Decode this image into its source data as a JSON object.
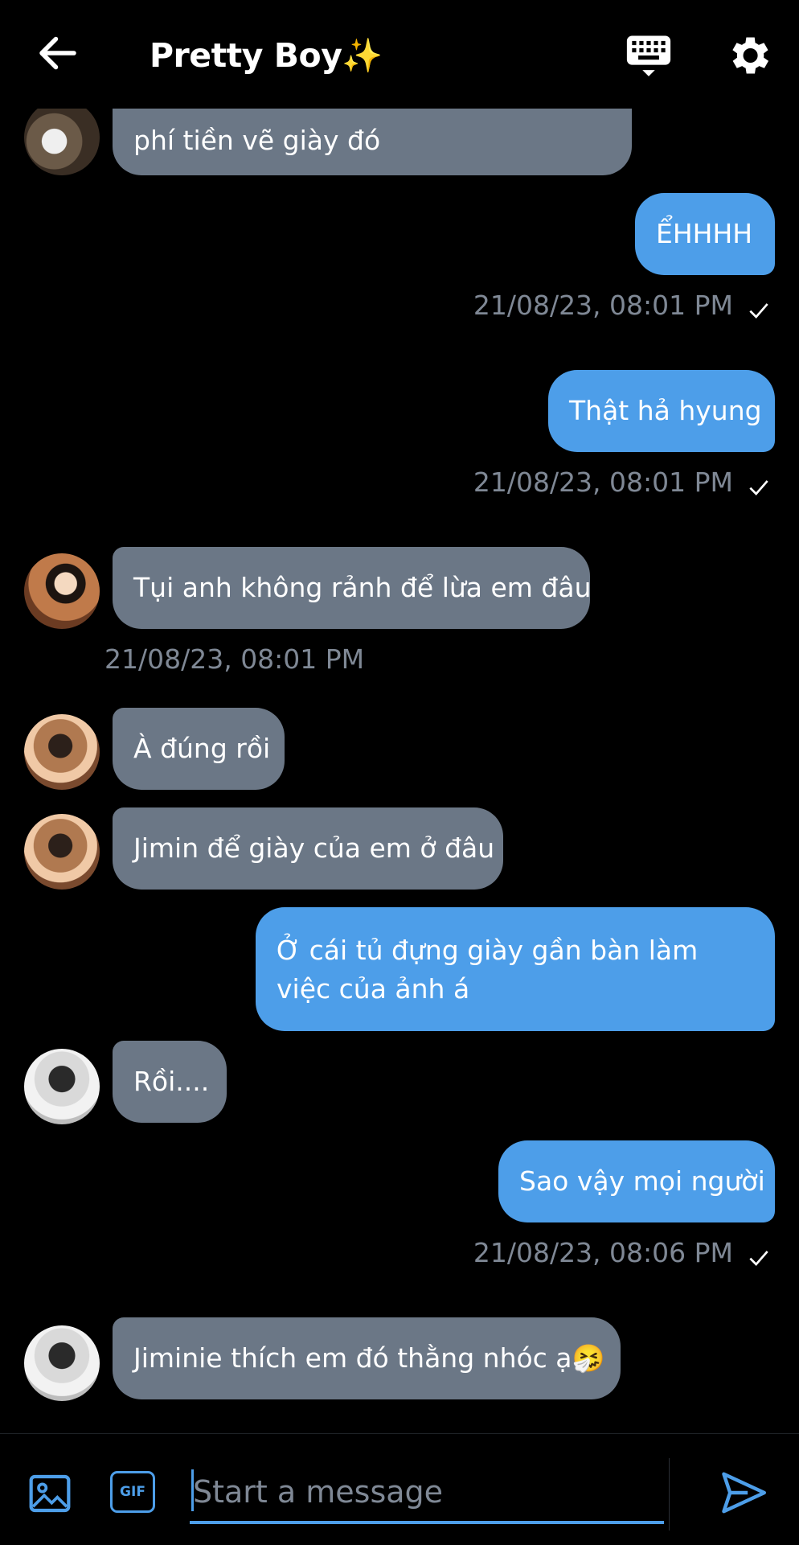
{
  "header": {
    "title": "Pretty Boy✨",
    "back_icon": "arrow-left-icon",
    "keyboard_icon": "keyboard-icon",
    "settings_icon": "gear-icon"
  },
  "messages": [
    {
      "dir": "in",
      "text": "phí tiền vẽ giày đó"
    },
    {
      "dir": "out",
      "text": "ỂHHHH"
    },
    {
      "dir": "meta",
      "text": "21/08/23, 08:01 PM"
    },
    {
      "dir": "out",
      "text": "Thật hả hyung"
    },
    {
      "dir": "meta",
      "text": "21/08/23, 08:01 PM"
    },
    {
      "dir": "in",
      "text": "Tụi anh không rảnh để lừa em đâu"
    },
    {
      "dir": "meta",
      "text": "21/08/23, 08:01 PM"
    },
    {
      "dir": "in",
      "text": "À đúng rồi"
    },
    {
      "dir": "in",
      "text": "Jimin để giày của em ở đâu"
    },
    {
      "dir": "out",
      "text": "Ở cái tủ đựng giày gần bàn làm việc của ảnh á"
    },
    {
      "dir": "in",
      "text": "Rồi...."
    },
    {
      "dir": "out",
      "text": "Sao vậy mọi người"
    },
    {
      "dir": "meta",
      "text": "21/08/23, 08:06 PM"
    },
    {
      "dir": "in",
      "text": "Jiminie thích em đó thằng nhóc ạ🤧"
    }
  ],
  "composer": {
    "placeholder": "Start a message",
    "value": "",
    "image_icon": "image-icon",
    "gif_label": "GIF",
    "send_icon": "send-icon"
  },
  "colors": {
    "background": "#000000",
    "incoming_bubble": "#6b7786",
    "outgoing_bubble": "#4d9ee9",
    "timestamp": "#7f8895",
    "accent": "#4d9ee9"
  }
}
